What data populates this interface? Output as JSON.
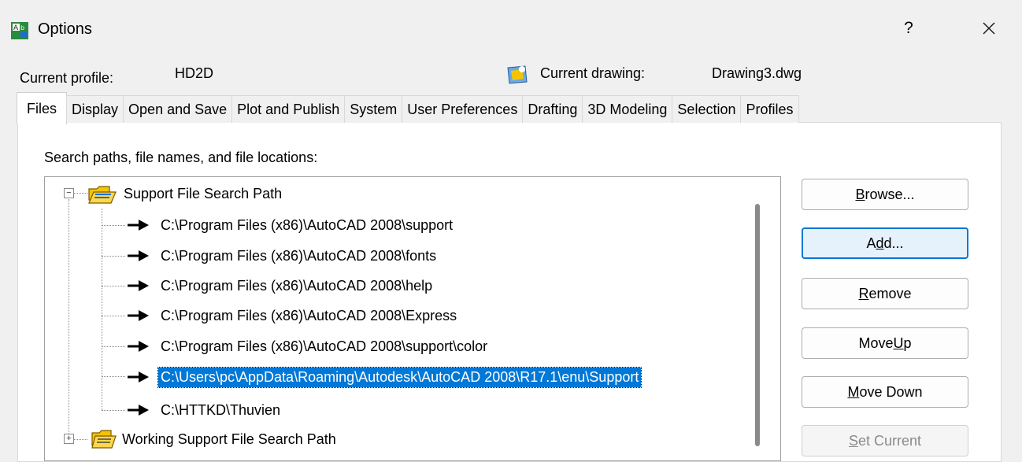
{
  "window": {
    "title": "Options",
    "help_label": "?",
    "close_label": "✕"
  },
  "profile": {
    "current_profile_label": "Current profile:",
    "current_profile_value": "HD2D",
    "current_drawing_label": "Current drawing:",
    "current_drawing_value": "Drawing3.dwg"
  },
  "tabs": [
    {
      "label": "Files",
      "active": true
    },
    {
      "label": "Display"
    },
    {
      "label": "Open and Save"
    },
    {
      "label": "Plot and Publish"
    },
    {
      "label": "System"
    },
    {
      "label": "User Preferences"
    },
    {
      "label": "Drafting"
    },
    {
      "label": "3D Modeling"
    },
    {
      "label": "Selection"
    },
    {
      "label": "Profiles"
    }
  ],
  "files": {
    "section_label": "Search paths, file names, and file locations:",
    "tree": {
      "support_node": {
        "label": "Support File Search Path",
        "expander": "−",
        "paths": [
          "C:\\Program Files (x86)\\AutoCAD 2008\\support",
          "C:\\Program Files (x86)\\AutoCAD 2008\\fonts",
          "C:\\Program Files (x86)\\AutoCAD 2008\\help",
          "C:\\Program Files (x86)\\AutoCAD 2008\\Express",
          "C:\\Program Files (x86)\\AutoCAD 2008\\support\\color",
          "C:\\Users\\pc\\AppData\\Roaming\\Autodesk\\AutoCAD 2008\\R17.1\\enu\\Support",
          "C:\\HTTKD\\Thuvien"
        ],
        "selected_index": 5
      },
      "working_node": {
        "label": "Working Support File Search Path",
        "expander": "+"
      }
    }
  },
  "buttons": {
    "browse": {
      "pre": "",
      "mnemonic": "B",
      "post": "rowse..."
    },
    "add": {
      "pre": "A",
      "mnemonic": "d",
      "post": "d..."
    },
    "remove": {
      "pre": "",
      "mnemonic": "R",
      "post": "emove"
    },
    "move_up": {
      "pre": "Move ",
      "mnemonic": "U",
      "post": "p"
    },
    "move_down": {
      "pre": "",
      "mnemonic": "M",
      "post": "ove Down"
    },
    "set_current": {
      "pre": "",
      "mnemonic": "S",
      "post": "et Current"
    }
  },
  "colors": {
    "selection": "#0078d7",
    "folder": "#f5c400"
  },
  "icons": {
    "app": "autocad-options-icon",
    "drawing": "current-drawing-icon",
    "folder": "folder-icon",
    "arrow": "arrow-right-icon"
  }
}
